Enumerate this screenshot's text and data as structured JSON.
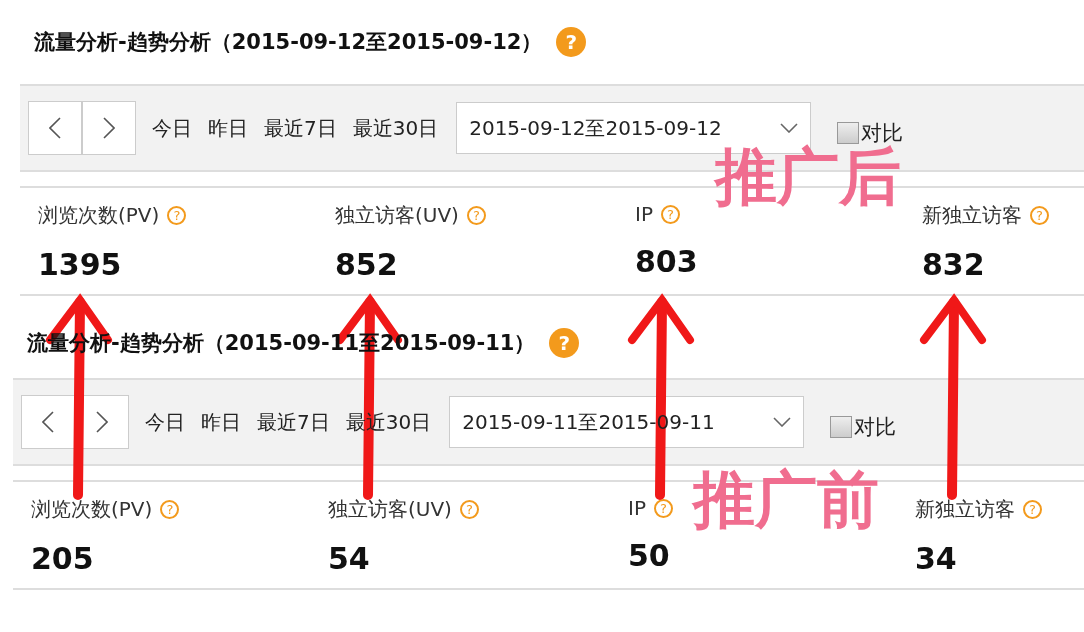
{
  "panels": [
    {
      "title": "流量分析-趋势分析（2015-09-12至2015-09-12）",
      "quick_ranges": [
        "今日",
        "昨日",
        "最近7日",
        "最近30日"
      ],
      "date_range": "2015-09-12至2015-09-12",
      "compare": {
        "label": "对比",
        "checked": false
      },
      "metrics": [
        {
          "label": "浏览次数(PV)",
          "value": "1395"
        },
        {
          "label": "独立访客(UV)",
          "value": "852"
        },
        {
          "label": "IP",
          "value": "803"
        },
        {
          "label": "新独立访客",
          "value": "832"
        }
      ]
    },
    {
      "title": "流量分析-趋势分析（2015-09-11至2015-09-11）",
      "quick_ranges": [
        "今日",
        "昨日",
        "最近7日",
        "最近30日"
      ],
      "date_range": "2015-09-11至2015-09-11",
      "compare": {
        "label": "对比",
        "checked": false
      },
      "metrics": [
        {
          "label": "浏览次数(PV)",
          "value": "205"
        },
        {
          "label": "独立访客(UV)",
          "value": "54"
        },
        {
          "label": "IP",
          "value": "50"
        },
        {
          "label": "新独立访客",
          "value": "34"
        }
      ]
    }
  ],
  "help_icon": "?",
  "annotations": [
    {
      "text": "推广后"
    },
    {
      "text": "推广前"
    }
  ]
}
